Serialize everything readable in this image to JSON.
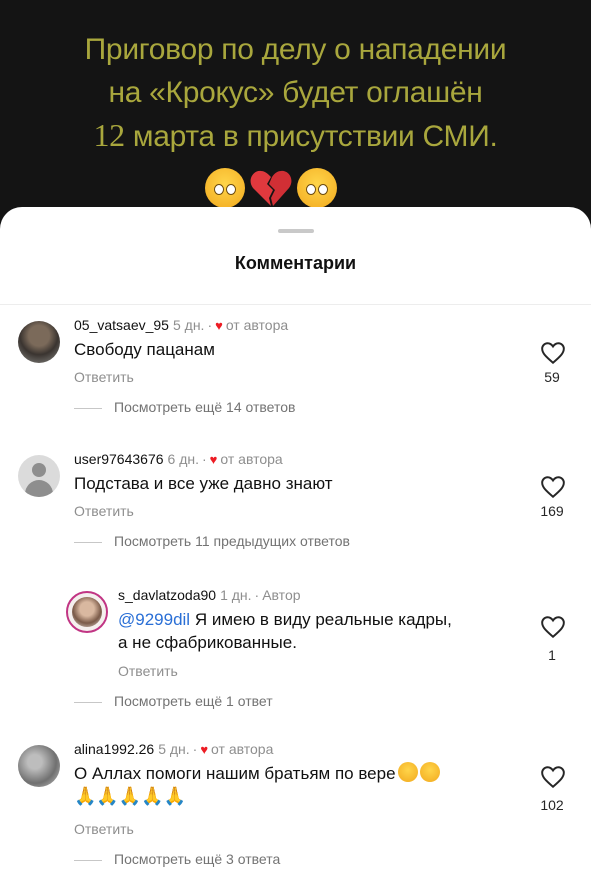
{
  "post": {
    "headline_line1": "Приговор по делу о нападении",
    "headline_line2": "на «Крокус» будет оглашён",
    "headline_num": "12",
    "headline_line3_rest": " марта в присутствии СМИ."
  },
  "sheet": {
    "title": "Комментарии"
  },
  "colors": {
    "accent_blue": "#2a6fd6",
    "author_heart": "#ed1c24",
    "meta_gray": "#8e8e8e",
    "headline_yellow": "#a9a73d"
  },
  "comments": [
    {
      "username": "05_vatsaev_95",
      "time": "5 дн.",
      "author_tag": "от автора",
      "text": "Свободу пацанам",
      "reply": "Ответить",
      "likes": "59",
      "view_more": "Посмотреть ещё 14 ответов"
    },
    {
      "username": "user97643676",
      "time": "6 дн.",
      "author_tag": "от автора",
      "text": "Подстава и все уже давно знают",
      "reply": "Ответить",
      "likes": "169",
      "view_more": "Посмотреть 11 предыдущих ответов"
    },
    {
      "username": "s_davlatzoda90",
      "time": "1 дн.",
      "author_tag": "Автор",
      "mention": "@9299dil",
      "text_line1": " Я имею в виду реальные кадры,",
      "text_line2": "а не сфабрикованные.",
      "reply": "Ответить",
      "likes": "1",
      "view_more": "Посмотреть ещё 1 ответ"
    },
    {
      "username": "alina1992.26",
      "time": "5 дн.",
      "author_tag": "от автора",
      "text_line1": "О Аллах помоги нашим братьям по вере",
      "text_line2": "🙏🙏🙏🙏🙏",
      "reply": "Ответить",
      "likes": "102",
      "view_more": "Посмотреть ещё 3 ответа"
    }
  ]
}
